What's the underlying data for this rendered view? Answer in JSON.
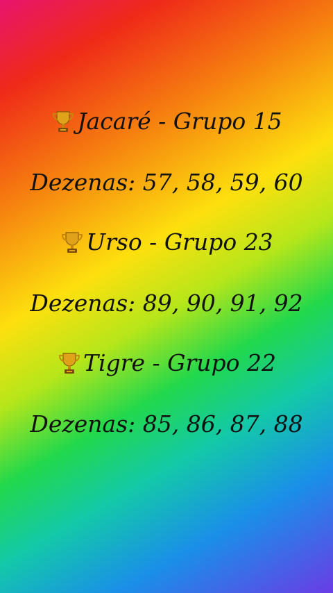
{
  "entries": [
    {
      "title": "Jacaré - Grupo 15",
      "dezenas": "Dezenas: 57, 58, 59, 60"
    },
    {
      "title": "Urso - Grupo 23",
      "dezenas": "Dezenas: 89, 90, 91, 92"
    },
    {
      "title": "Tigre - Grupo 22",
      "dezenas": "Dezenas: 85, 86, 87, 88"
    }
  ],
  "icon": "trophy-icon",
  "colors": {
    "text": "#111111",
    "gradient": [
      "#e8146e",
      "#ef2a18",
      "#f6820f",
      "#fde00e",
      "#22d84c",
      "#13c9a8",
      "#1a8fe8",
      "#6a3ce6"
    ]
  }
}
